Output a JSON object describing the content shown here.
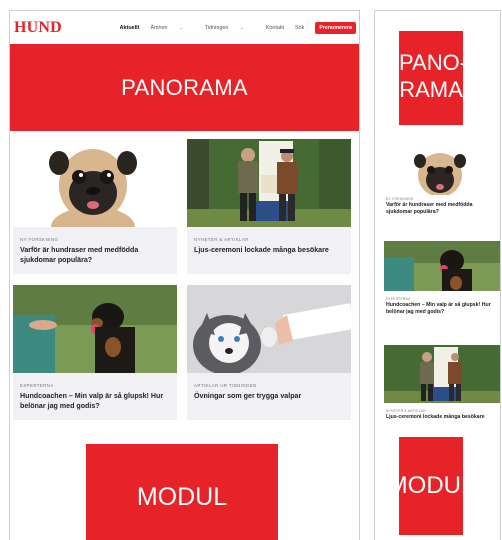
{
  "brand": {
    "logo_text": "HUND",
    "accent_color": "#e52329"
  },
  "nav": {
    "items": [
      {
        "label": "Aktuellt",
        "active": true,
        "dropdown": false
      },
      {
        "label": "Ämnen",
        "active": false,
        "dropdown": true
      },
      {
        "label": "Tidningen",
        "active": false,
        "dropdown": true
      },
      {
        "label": "Kontakt",
        "active": false,
        "dropdown": false
      },
      {
        "label": "Sök",
        "active": false,
        "dropdown": false
      }
    ],
    "subscribe_label": "Prenumerera"
  },
  "panorama": {
    "label": "PANORAMA"
  },
  "articles": [
    {
      "category": "NY FORSKNING",
      "title": "Varför är hundraser med medfödda sjukdomar populära?",
      "image": "pug-photo"
    },
    {
      "category": "NYHETER & ARTIKLAR",
      "title": "Ljus-ceremoni lockade många besökare",
      "image": "two-men-forest-photo"
    },
    {
      "category": "EXPERTERNA",
      "title": "Hundcoachen – Min valp är så glupsk! Hur belönar jag med godis?",
      "image": "rottweiler-photo"
    },
    {
      "category": "ARTIKLAR UR TIDNINGEN",
      "title": "Övningar som ger trygga valpar",
      "image": "husky-high-five-photo"
    }
  ],
  "modul": {
    "label": "MODUL"
  },
  "mobile": {
    "panorama_label": "PANO-\nRAMA",
    "panorama_line1": "PANO-",
    "panorama_line2": "RAMA",
    "cards": [
      {
        "category": "NY FORSKNING",
        "title": "Varför är hundraser med medfödda sjukdomar populära?"
      },
      {
        "category": "EXPERTERNA",
        "title": "Hundcoachen – Min valp är så glupsk! Hur belönar jag med godis?"
      },
      {
        "category": "NYHETER & ARTIKLAR",
        "title": "Ljus-ceremoni lockade många besökare"
      }
    ],
    "modul_label": "MODUL"
  }
}
